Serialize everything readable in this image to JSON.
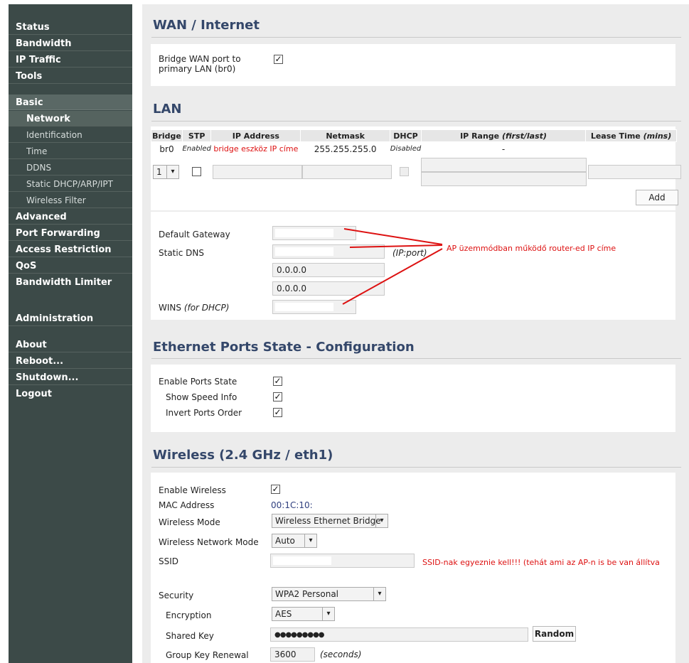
{
  "sidebar": {
    "status": "Status",
    "bandwidth": "Bandwidth",
    "ip_traffic": "IP Traffic",
    "tools": "Tools",
    "basic": "Basic",
    "network": "Network",
    "identification": "Identification",
    "time": "Time",
    "ddns": "DDNS",
    "static_dhcp": "Static DHCP/ARP/IPT",
    "wireless_filter": "Wireless Filter",
    "advanced": "Advanced",
    "port_forwarding": "Port Forwarding",
    "access_restriction": "Access Restriction",
    "qos": "QoS",
    "bandwidth_limiter": "Bandwidth Limiter",
    "administration": "Administration",
    "about": "About",
    "reboot": "Reboot...",
    "shutdown": "Shutdown...",
    "logout": "Logout"
  },
  "wan": {
    "title": "WAN / Internet",
    "bridge_label_1": "Bridge WAN port to",
    "bridge_label_2": "primary LAN (br0)",
    "bridge_checked": "✓"
  },
  "lan": {
    "title": "LAN",
    "headers": {
      "bridge": "Bridge",
      "stp": "STP",
      "ip": "IP Address",
      "netmask": "Netmask",
      "dhcp": "DHCP",
      "ip_range": "IP Range ",
      "ip_range_it": "(first/last)",
      "lease": "Lease Time ",
      "lease_it": "(mins)"
    },
    "row": {
      "bridge": "br0",
      "stp": "Enabled",
      "ip_annotation": "bridge eszköz IP címe",
      "netmask": "255.255.255.0",
      "dhcp": "Disabled",
      "ip_range": "-"
    },
    "new_bridge_value": "1",
    "add_button": "Add"
  },
  "gateway": {
    "default_gateway": "Default Gateway",
    "static_dns": "Static DNS",
    "dns_hint": "(IP:port)",
    "dns2": "0.0.0.0",
    "dns3": "0.0.0.0",
    "wins": "WINS ",
    "wins_it": "(for DHCP)",
    "annotation": "AP üzemmódban működő router-ed IP címe"
  },
  "ethernet": {
    "title": "Ethernet Ports State - Configuration",
    "enable": "Enable Ports State",
    "speed": "Show Speed Info",
    "invert": "Invert Ports Order",
    "check": "✓"
  },
  "wireless": {
    "title": "Wireless (2.4 GHz / eth1)",
    "enable": "Enable Wireless",
    "enable_check": "✓",
    "mac_label": "MAC Address",
    "mac_value": "00:1C:10:",
    "mode_label": "Wireless Mode",
    "mode_value": "Wireless Ethernet Bridge",
    "netmode_label": "Wireless Network Mode",
    "netmode_value": "Auto",
    "ssid_label": "SSID",
    "ssid_annotation": "SSID-nak egyeznie kell!!! (tehát ami az AP-n is be van állítva",
    "security_label": "Security",
    "security_value": "WPA2 Personal",
    "encryption_label": "Encryption",
    "encryption_value": "AES",
    "shared_key_label": "Shared Key",
    "shared_key_value": "●●●●●●●●●",
    "random_button": "Random",
    "group_key_label": "Group Key Renewal",
    "group_key_value": "3600",
    "group_key_unit": "(seconds)"
  },
  "colors": {
    "sidebar_bg": "#3c4a48",
    "title": "#34476a",
    "annotation": "#dd1111",
    "mac": "#2f3f7f"
  }
}
